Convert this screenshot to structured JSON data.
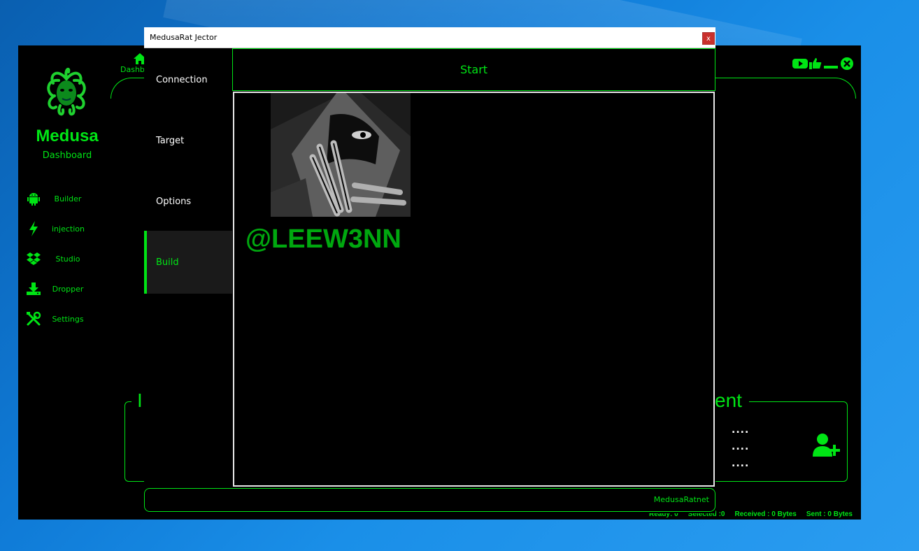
{
  "sidebar": {
    "brand_title": "Medusa",
    "brand_subtitle": "Dashboard",
    "items": [
      {
        "label": "Builder",
        "icon": "android-icon"
      },
      {
        "label": "injection",
        "icon": "bolt-icon"
      },
      {
        "label": "Studio",
        "icon": "dropbox-icon"
      },
      {
        "label": "Dropper",
        "icon": "download-icon"
      },
      {
        "label": "Settings",
        "icon": "tools-icon"
      }
    ]
  },
  "header": {
    "home_label": "Dashb",
    "controls": [
      "youtube-icon",
      "thumbs-up-icon",
      "minimize-icon",
      "close-circle-icon"
    ]
  },
  "panels": {
    "left_title_fragment": "I",
    "right_title_fragment": "ent",
    "dots": [
      "....",
      "....",
      "...."
    ]
  },
  "status": {
    "ready": "Ready: 0",
    "selected": "Selected :0",
    "received": "Received : 0 Bytes",
    "sent": "Sent : 0 Bytes"
  },
  "jector": {
    "title": "MedusaRat Jector",
    "close_label": "x",
    "tabs": [
      {
        "label": "Connection"
      },
      {
        "label": "Target"
      },
      {
        "label": "Options"
      },
      {
        "label": "Build",
        "active": true
      }
    ],
    "start_label": "Start",
    "watermark": "@LEEW3NN",
    "footer_link": "MedusaRatnet"
  },
  "colors": {
    "accent": "#00e515",
    "background": "#000000",
    "desktop": "#1a8fe8"
  }
}
